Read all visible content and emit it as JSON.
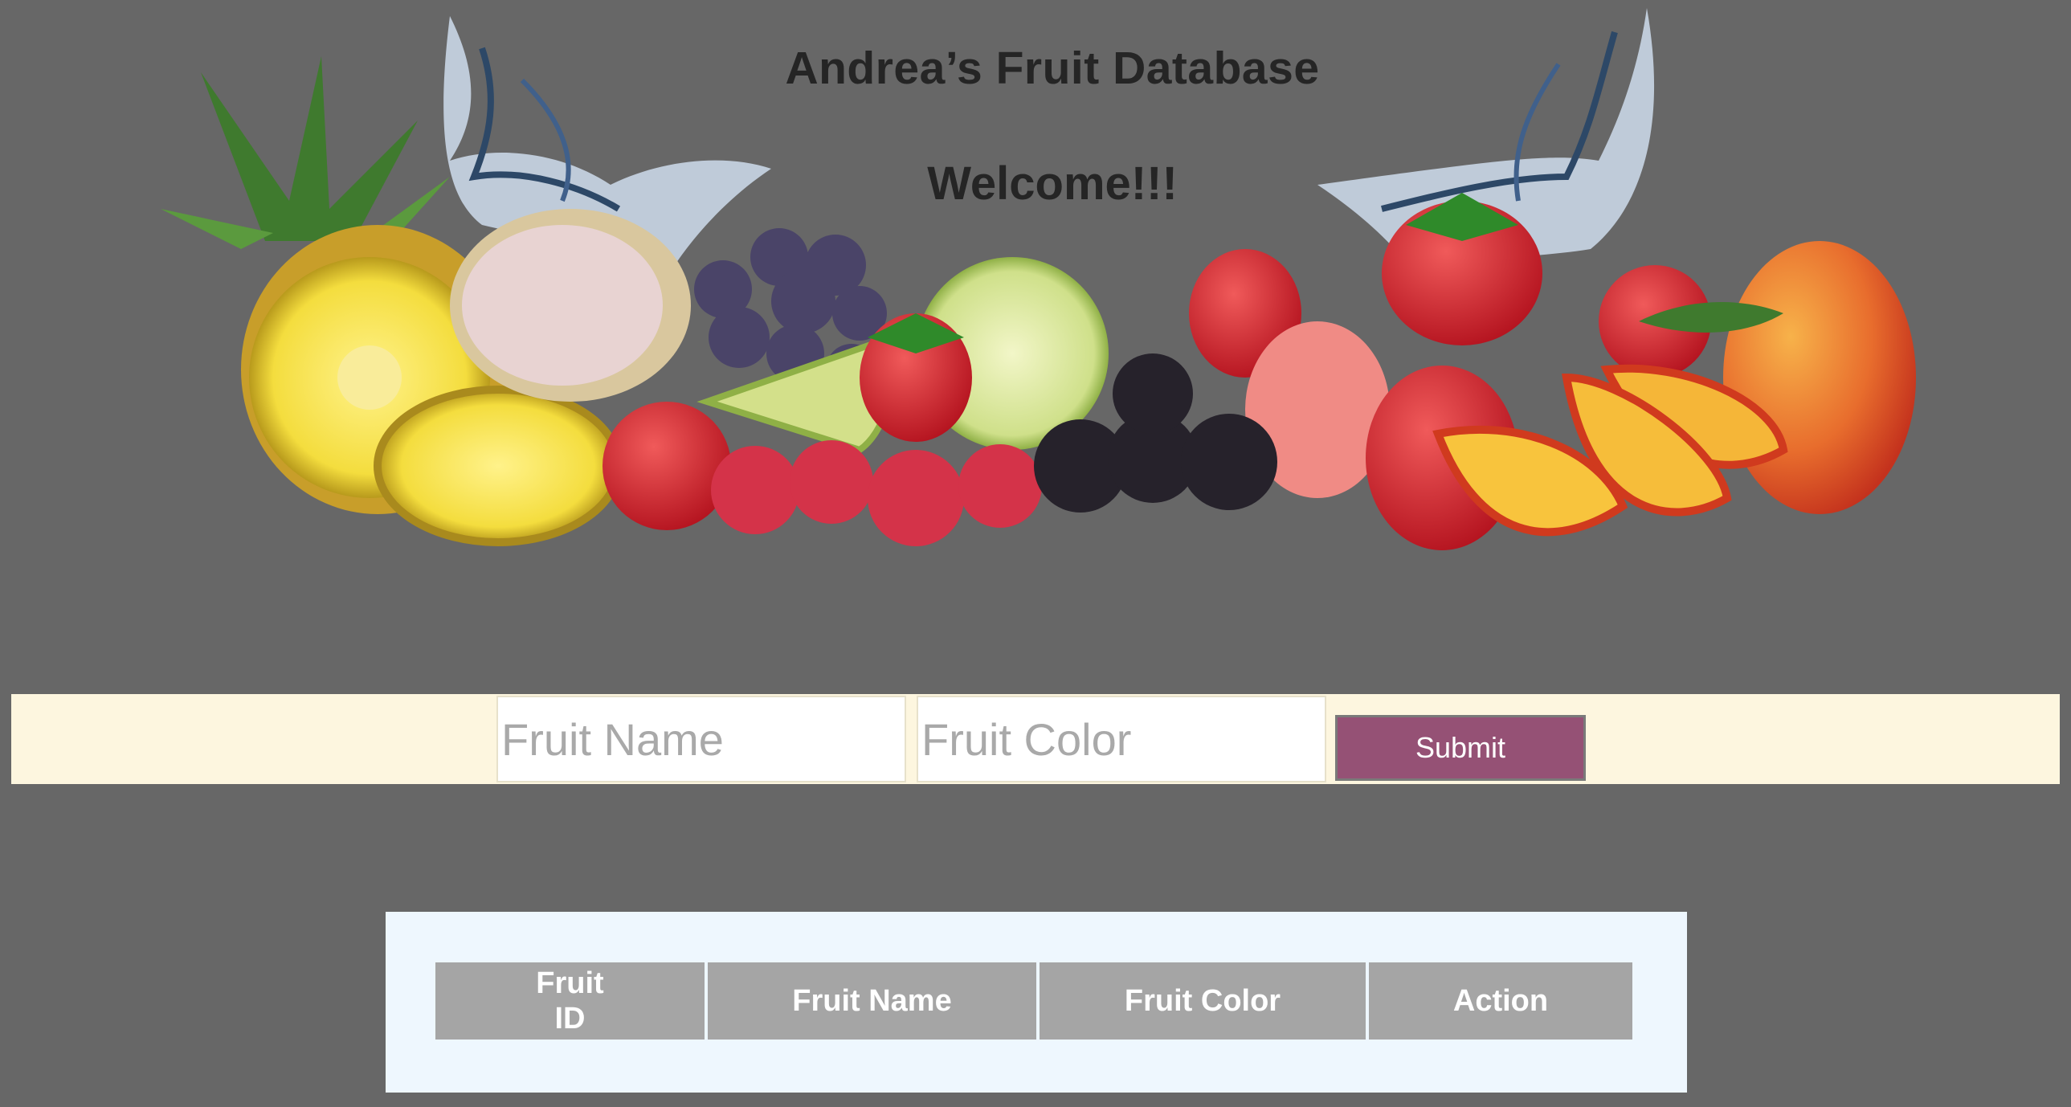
{
  "header": {
    "title": "Andrea’s Fruit Database",
    "welcome": "Welcome!!!"
  },
  "hero_image": {
    "icon": "fruit-banner-image",
    "fruits": [
      "pineapple",
      "coconut",
      "grapes",
      "lime",
      "strawberry",
      "raspberry",
      "blackberry",
      "peach"
    ]
  },
  "form": {
    "fruit_name_placeholder": "Fruit Name",
    "fruit_name_value": "",
    "fruit_color_placeholder": "Fruit Color",
    "fruit_color_value": "",
    "submit_label": "Submit"
  },
  "table": {
    "columns": [
      "Fruit\nID",
      "Fruit Name",
      "Fruit Color",
      "Action"
    ],
    "rows": []
  },
  "colors": {
    "page_background": "#676767",
    "form_bar_background": "#fdf6df",
    "submit_background": "#955175",
    "table_panel_background": "#eef7fe",
    "table_header_background": "#a5a5a5"
  }
}
